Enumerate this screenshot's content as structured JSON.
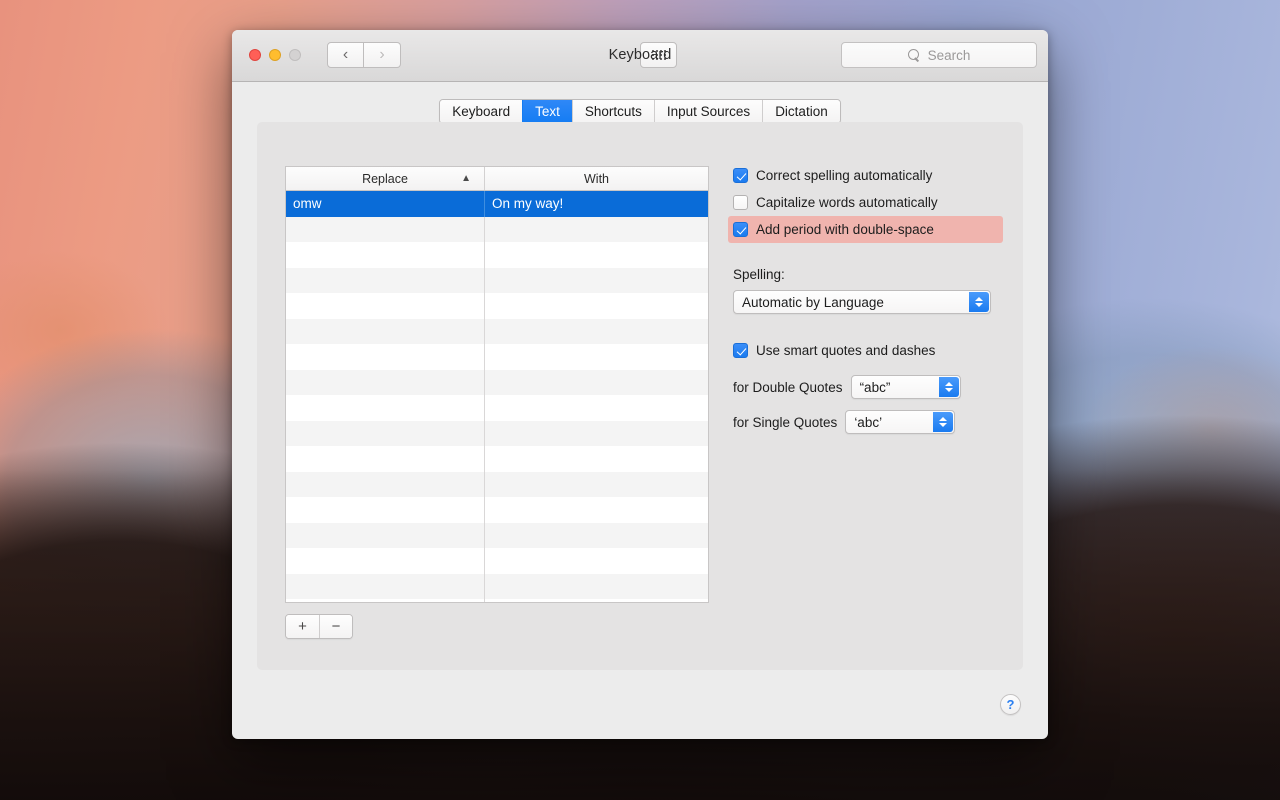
{
  "window": {
    "title": "Keyboard",
    "traffic_lights": [
      "close",
      "minimize",
      "zoom"
    ],
    "nav": {
      "back": "‹",
      "forward": "›"
    },
    "grid_button": "all-preferences",
    "search": {
      "placeholder": "Search",
      "value": ""
    }
  },
  "tabs": [
    {
      "label": "Keyboard",
      "active": false
    },
    {
      "label": "Text",
      "active": true
    },
    {
      "label": "Shortcuts",
      "active": false
    },
    {
      "label": "Input Sources",
      "active": false
    },
    {
      "label": "Dictation",
      "active": false
    }
  ],
  "table": {
    "columns": [
      {
        "label": "Replace",
        "sort": "ascending",
        "sort_glyph": "▲"
      },
      {
        "label": "With",
        "sort": "none"
      }
    ],
    "rows": [
      {
        "replace": "omw",
        "with": "On my way!",
        "selected": true
      }
    ],
    "empty_row_count": 15,
    "controls": {
      "add": "+",
      "remove": "−"
    }
  },
  "options": {
    "checkboxes": [
      {
        "label": "Correct spelling automatically",
        "checked": true,
        "highlighted": false
      },
      {
        "label": "Capitalize words automatically",
        "checked": false,
        "highlighted": false
      },
      {
        "label": "Add period with double-space",
        "checked": true,
        "highlighted": true
      }
    ],
    "spelling": {
      "label": "Spelling:",
      "value": "Automatic by Language"
    },
    "smart_quotes": {
      "label": "Use smart quotes and dashes",
      "checked": true,
      "double_quotes": {
        "label": "for Double Quotes",
        "value": "“abc”"
      },
      "single_quotes": {
        "label": "for Single Quotes",
        "value": "‘abc’"
      }
    }
  },
  "help": {
    "label": "?"
  },
  "colors": {
    "accent_blue": "#147cf3",
    "selection_blue": "#0a6cd8",
    "highlight_pink": "#f0b4ae",
    "window_bg": "#ececec",
    "panel_bg": "#e4e3e3"
  }
}
